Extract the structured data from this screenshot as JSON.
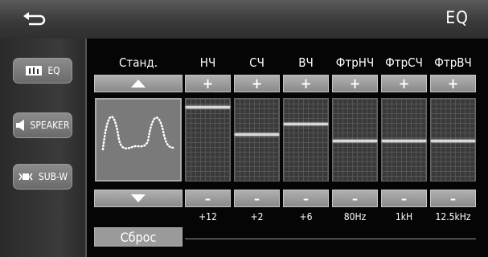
{
  "header": {
    "title": "EQ",
    "back_icon": "back-arrow-icon"
  },
  "sidebar": {
    "items": [
      {
        "label": "EQ",
        "icon": "eq-icon"
      },
      {
        "label": "SPEAKER",
        "icon": "speaker-icon"
      },
      {
        "label": "SUB-W",
        "icon": "subwoofer-icon"
      }
    ]
  },
  "preset": {
    "label": "Станд.",
    "up_icon": "triangle-up-icon",
    "down_icon": "triangle-down-icon"
  },
  "bands": [
    {
      "label": "НЧ",
      "value": "+12",
      "plus": "+",
      "minus": "–",
      "level": 0.95
    },
    {
      "label": "СЧ",
      "value": "+2",
      "plus": "+",
      "minus": "–",
      "level": 0.58
    },
    {
      "label": "ВЧ",
      "value": "+6",
      "plus": "+",
      "minus": "–",
      "level": 0.72
    },
    {
      "label": "ФтрНЧ",
      "value": "80Hz",
      "plus": "+",
      "minus": "–",
      "level": 0.5
    },
    {
      "label": "ФтрСЧ",
      "value": "1kH",
      "plus": "+",
      "minus": "–",
      "level": 0.5
    },
    {
      "label": "ФтрВЧ",
      "value": "12.5kHz",
      "plus": "+",
      "minus": "–",
      "level": 0.5
    }
  ],
  "reset": {
    "label": "Сброс"
  }
}
